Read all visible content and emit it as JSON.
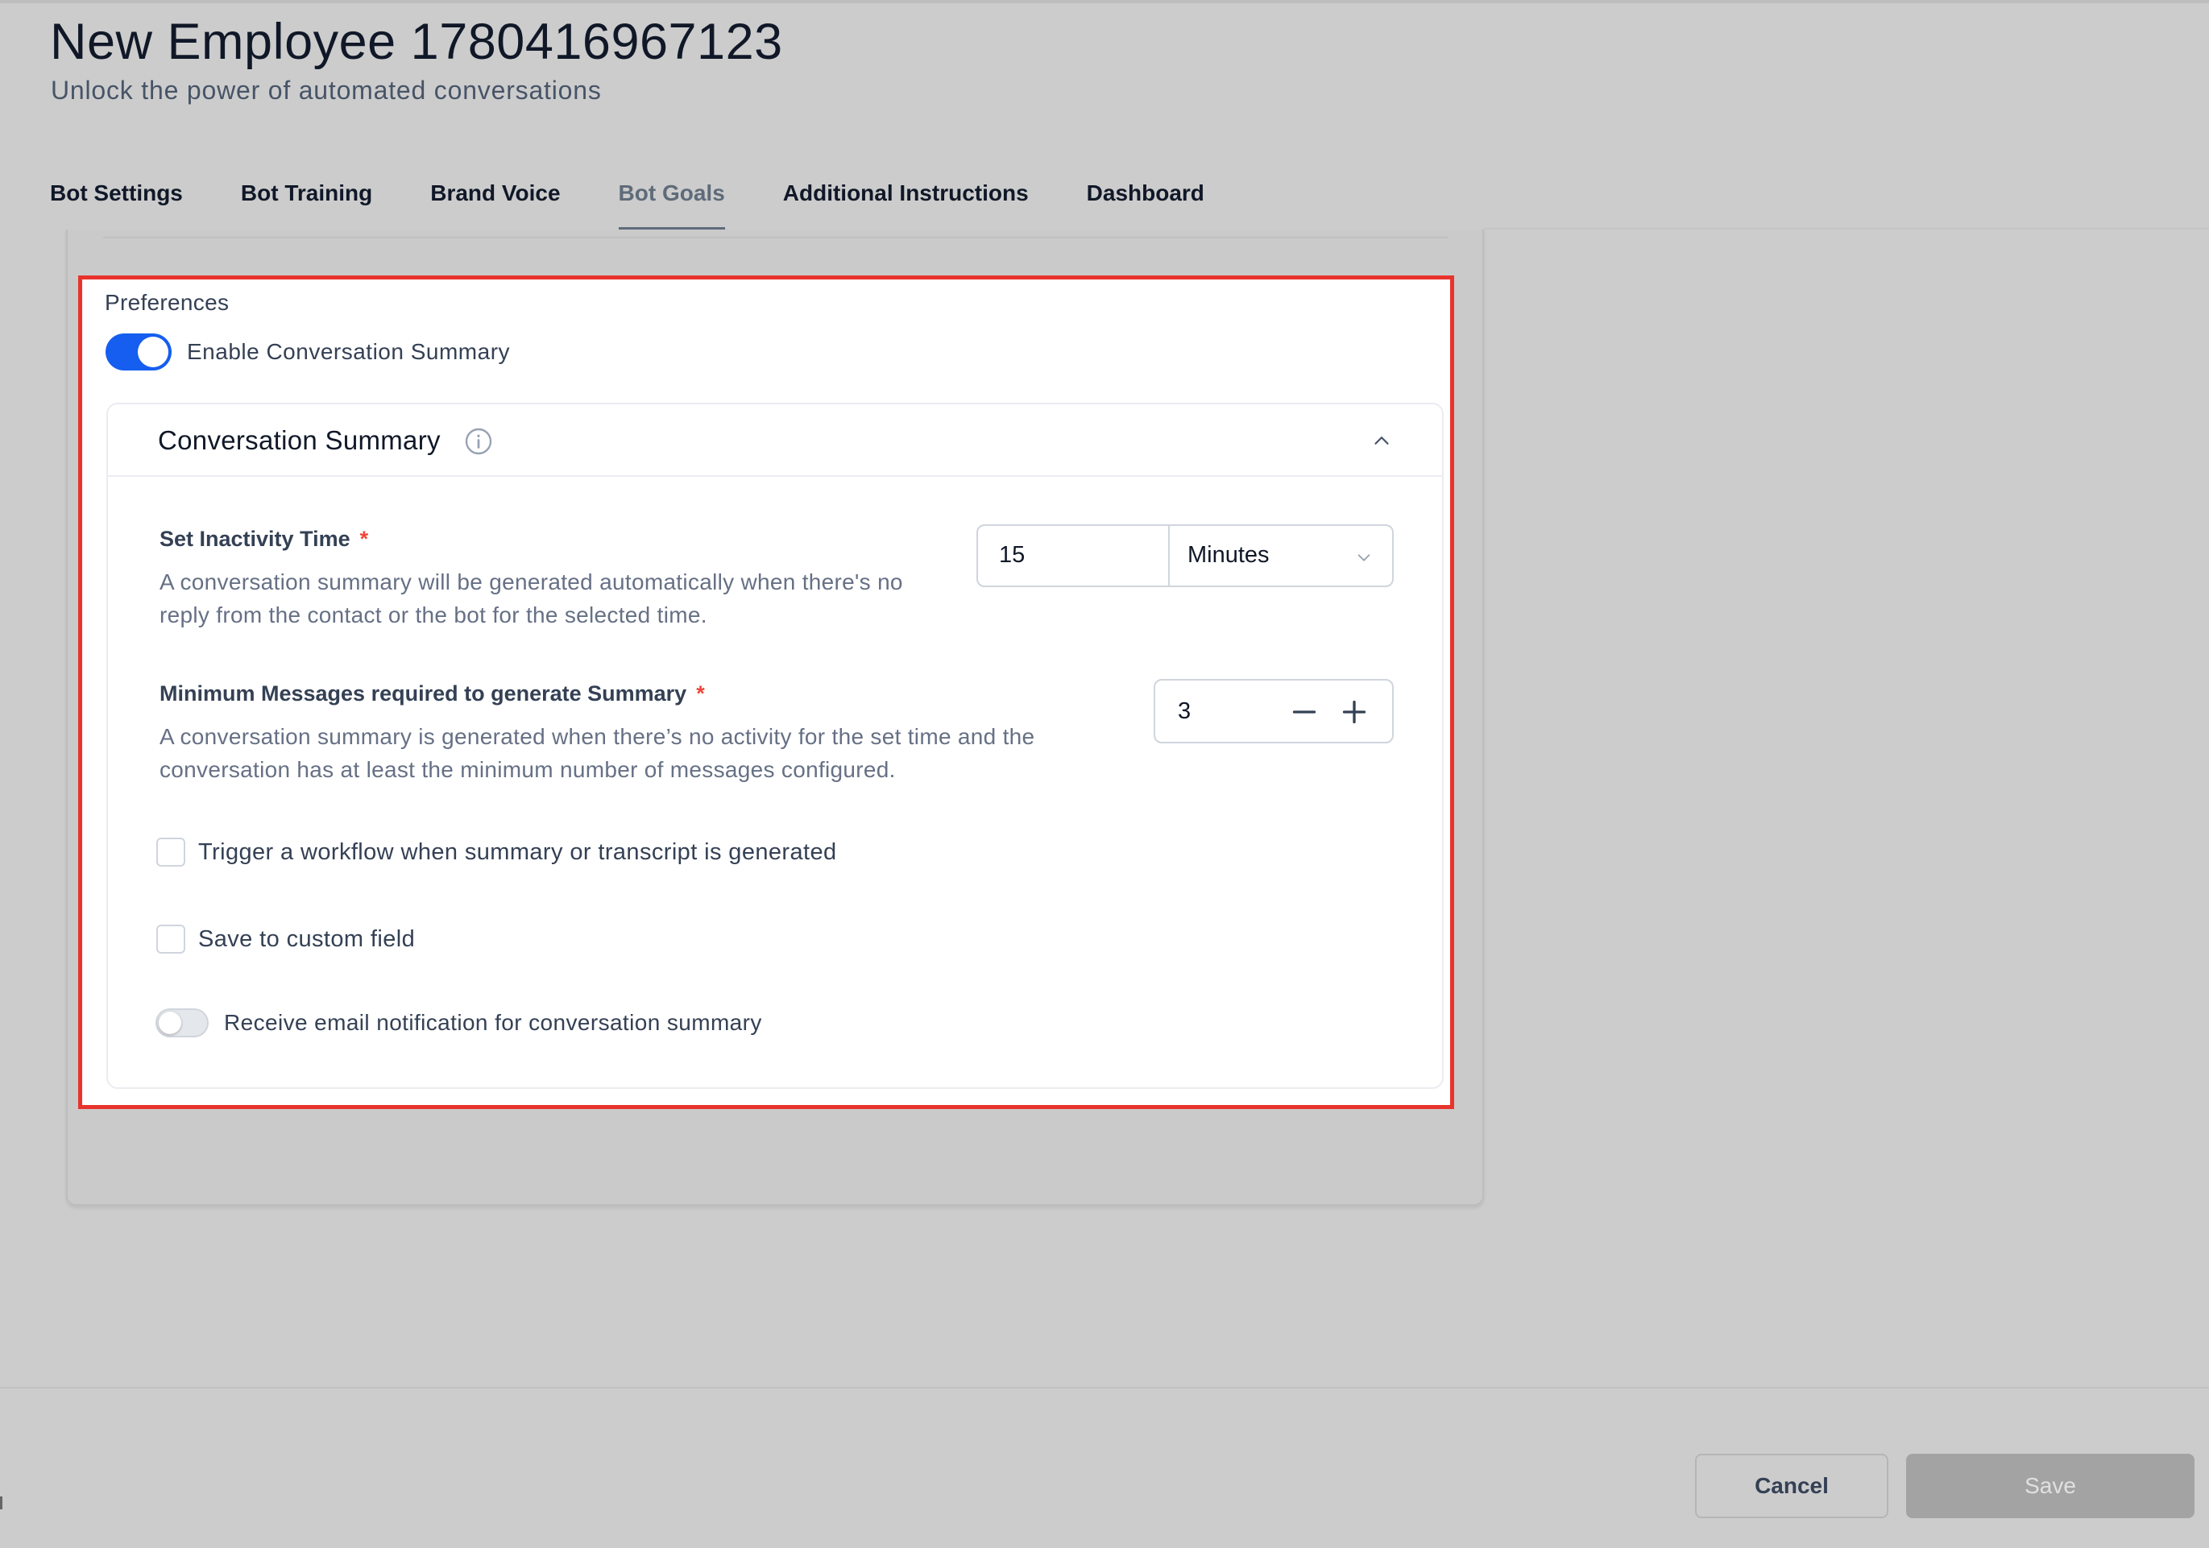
{
  "header": {
    "title": "New Employee 1780416967123",
    "subtitle": "Unlock the power of automated conversations"
  },
  "tabs": [
    {
      "label": "Bot Settings"
    },
    {
      "label": "Bot Training"
    },
    {
      "label": "Brand Voice"
    },
    {
      "label": "Bot Goals",
      "active": true
    },
    {
      "label": "Additional Instructions"
    },
    {
      "label": "Dashboard"
    }
  ],
  "preferences": {
    "label": "Preferences",
    "enable_summary_label": "Enable Conversation Summary",
    "enable_summary_on": true
  },
  "summary": {
    "title": "Conversation Summary",
    "inactivity": {
      "label": "Set Inactivity Time",
      "required_mark": "*",
      "help_line1": "A conversation summary will be generated automatically when there's no",
      "help_line2": "reply from the contact or the bot for the selected time.",
      "value": "15",
      "unit": "Minutes"
    },
    "min_messages": {
      "label": "Minimum Messages required to generate Summary",
      "required_mark": "*",
      "help_line1": "A conversation summary is generated when there’s no activity for the set time and the",
      "help_line2": "conversation has at least the minimum number of messages configured.",
      "value": "3"
    },
    "trigger_workflow_label": "Trigger a workflow when summary or transcript is generated",
    "trigger_workflow_checked": false,
    "save_custom_field_label": "Save to custom field",
    "save_custom_field_checked": false,
    "email_notification_label": "Receive email notification for conversation summary",
    "email_notification_on": false
  },
  "footer": {
    "cancel_label": "Cancel",
    "save_label": "Save"
  },
  "colors": {
    "accent": "#155eef",
    "highlight_border": "#e8332d",
    "required": "#f04438"
  }
}
